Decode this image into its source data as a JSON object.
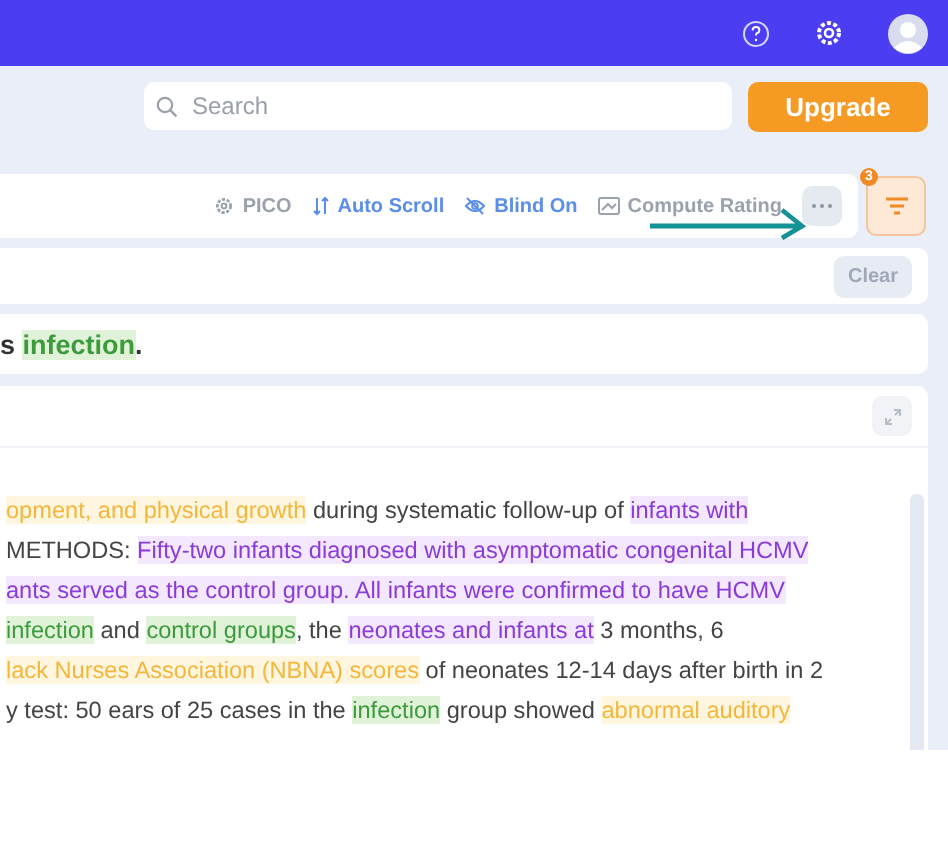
{
  "search": {
    "placeholder": "Search"
  },
  "upgrade_button": "Upgrade",
  "toolbar": {
    "items": [
      {
        "kind": "pico",
        "label": "PICO"
      },
      {
        "kind": "autoscroll",
        "label": "Auto Scroll"
      },
      {
        "kind": "blind",
        "label": "Blind On"
      },
      {
        "kind": "rating",
        "label": "Compute Rating"
      }
    ],
    "filter_badge": "3"
  },
  "clear_button": "Clear",
  "title_segments": [
    {
      "text": "s ",
      "kind": "plain"
    },
    {
      "text": "infection",
      "kind": "green"
    },
    {
      "text": ".",
      "kind": "plain"
    }
  ],
  "abstract_lines": [
    [
      {
        "text": "opment, and physical growth",
        "kind": "orange"
      },
      {
        "text": " during systematic follow-up of ",
        "kind": "plain"
      },
      {
        "text": "infants with",
        "kind": "purple"
      }
    ],
    [
      {
        "text": "METHODS: ",
        "kind": "plain"
      },
      {
        "text": "Fifty-two infants diagnosed with asymptomatic congenital HCMV",
        "kind": "purple"
      }
    ],
    [
      {
        "text": "ants served as the control group. All infants were confirmed to have HCMV",
        "kind": "purple"
      }
    ],
    [
      {
        "text": "infection",
        "kind": "green"
      },
      {
        "text": " and ",
        "kind": "plain"
      },
      {
        "text": "control groups",
        "kind": "green"
      },
      {
        "text": ", the ",
        "kind": "plain"
      },
      {
        "text": "neonates and infants at",
        "kind": "purple"
      },
      {
        "text": " 3 months, 6",
        "kind": "plain"
      }
    ],
    [
      {
        "text": "lack Nurses Association (NBNA) scores",
        "kind": "orange"
      },
      {
        "text": " of neonates 12-14 days after birth in 2",
        "kind": "plain"
      }
    ],
    [
      {
        "text": "y test: 50 ears of 25 cases in the ",
        "kind": "plain"
      },
      {
        "text": "infection",
        "kind": "green"
      },
      {
        "text": " group showed ",
        "kind": "plain"
      },
      {
        "text": "abnormal auditory",
        "kind": "orange"
      }
    ]
  ]
}
